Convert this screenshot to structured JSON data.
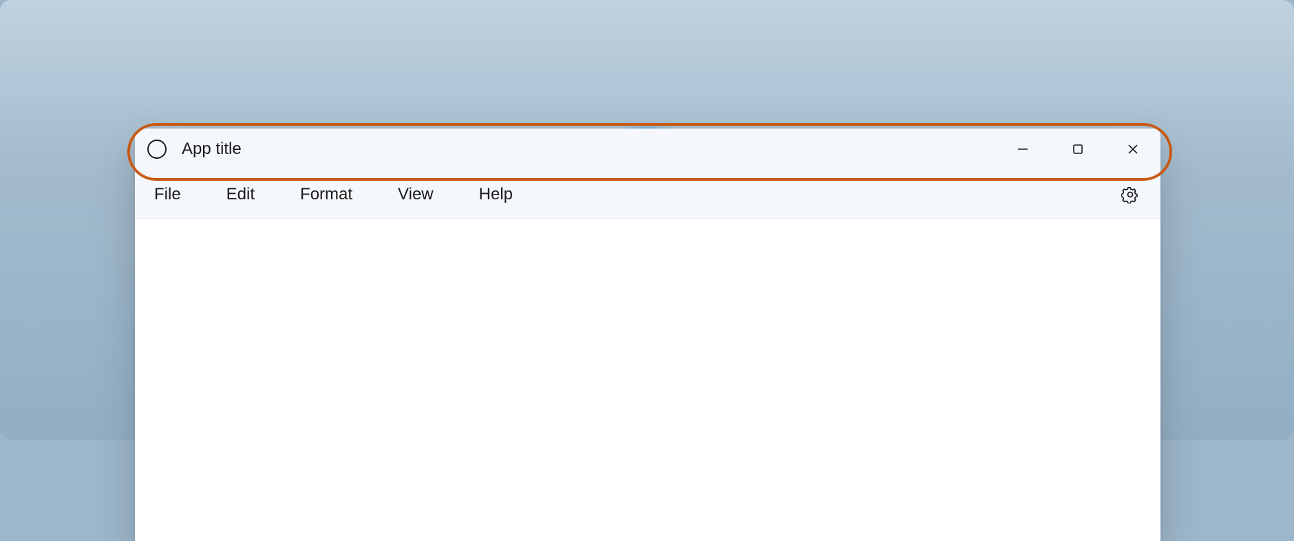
{
  "titlebar": {
    "app_title": "App title",
    "app_icon_name": "circle-icon",
    "caption": {
      "minimize_name": "minimize-icon",
      "maximize_name": "maximize-icon",
      "close_name": "close-icon"
    }
  },
  "menubar": {
    "items": [
      {
        "label": "File"
      },
      {
        "label": "Edit"
      },
      {
        "label": "Format"
      },
      {
        "label": "View"
      },
      {
        "label": "Help"
      }
    ],
    "settings_icon_name": "gear-icon"
  },
  "colors": {
    "highlight_stroke": "#c75a14",
    "titlebar_bg": "#f4f7fb",
    "window_bg": "#ffffff",
    "desktop_top": "#c0d2e0",
    "desktop_bottom": "#93aec4"
  }
}
